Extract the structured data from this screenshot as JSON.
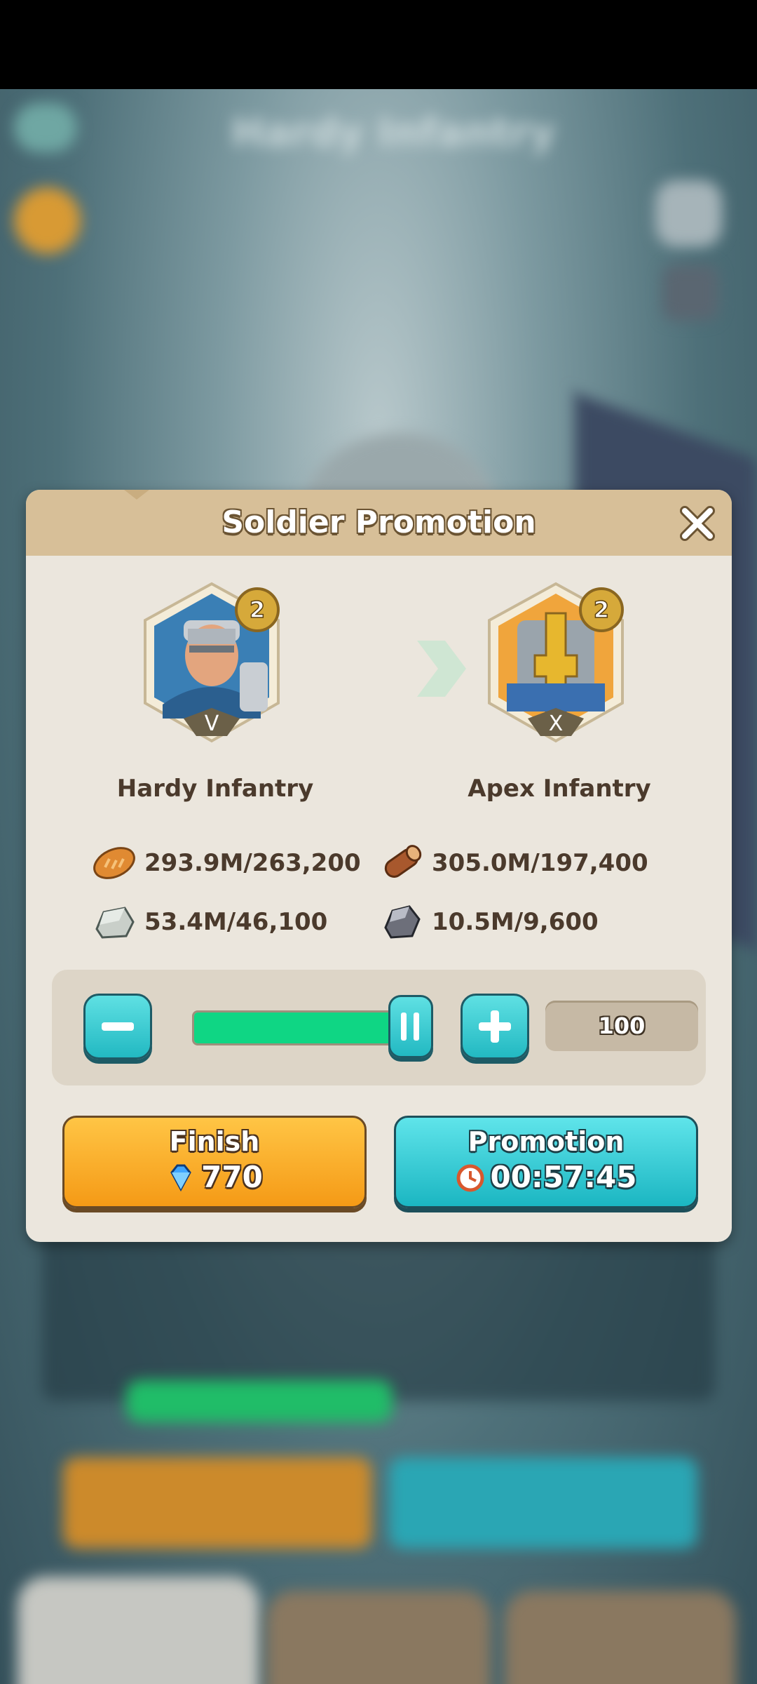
{
  "background": {
    "title": "Hardy Infantry"
  },
  "modal": {
    "title": "Soldier Promotion",
    "from_unit": {
      "name": "Hardy Infantry",
      "tier": "V",
      "level": "2"
    },
    "to_unit": {
      "name": "Apex Infantry",
      "tier": "X",
      "level": "2"
    },
    "resources": [
      {
        "icon": "bread-icon",
        "value": "293.9M/263,200"
      },
      {
        "icon": "wood-log-icon",
        "value": "305.0M/197,400"
      },
      {
        "icon": "stone-icon",
        "value": "53.4M/46,100"
      },
      {
        "icon": "iron-ore-icon",
        "value": "10.5M/9,600"
      }
    ],
    "quantity": {
      "value": "100",
      "slider_fraction": 1.0
    },
    "finish_button": {
      "label": "Finish",
      "cost": "770"
    },
    "promotion_button": {
      "label": "Promotion",
      "time": "00:57:45"
    }
  },
  "colors": {
    "header": "#d7bf98",
    "panel": "#ebe6dd",
    "finish": "#f5a623",
    "promotion": "#2bc3cc",
    "slider_fill": "#0fd684"
  }
}
